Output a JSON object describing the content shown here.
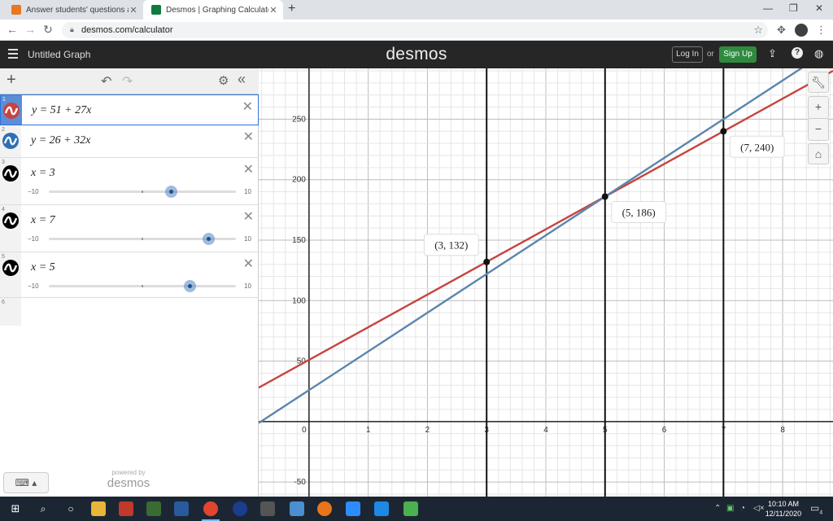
{
  "browser": {
    "tabs": [
      {
        "title": "Answer students' questions and e",
        "icon": "chegg-icon",
        "active": false
      },
      {
        "title": "Desmos | Graphing Calculator",
        "icon": "desmos-icon",
        "active": true
      }
    ],
    "url": "desmos.com/calculator"
  },
  "header": {
    "graph_title": "Untitled Graph",
    "logo": "desmos",
    "login_label": "Log In",
    "or_label": "or",
    "signup_label": "Sign Up"
  },
  "expressions": [
    {
      "index": "1",
      "latex": "y = 51 + 27x",
      "color": "#c74440",
      "selected": true
    },
    {
      "index": "2",
      "latex": "y = 26 + 32x",
      "color": "#2d70b3",
      "selected": false
    },
    {
      "index": "3",
      "latex": "x = 3",
      "color": "#000000",
      "slider": {
        "min": "−10",
        "max": "10",
        "value": 3
      }
    },
    {
      "index": "4",
      "latex": "x = 7",
      "color": "#000000",
      "slider": {
        "min": "−10",
        "max": "10",
        "value": 7
      }
    },
    {
      "index": "5",
      "latex": "x = 5",
      "color": "#000000",
      "slider": {
        "min": "−10",
        "max": "10",
        "value": 5
      }
    },
    {
      "index": "6",
      "latex": ""
    }
  ],
  "powered_by": {
    "small": "powered by",
    "brand": "desmos"
  },
  "graph": {
    "x_range": [
      -0.85,
      8.85
    ],
    "y_range": [
      -62,
      292
    ],
    "x_ticks": [
      "0",
      "1",
      "2",
      "3",
      "4",
      "5",
      "6",
      "7",
      "8"
    ],
    "y_ticks": [
      "-50",
      "50",
      "100",
      "150",
      "200",
      "250"
    ],
    "lines": [
      {
        "intercept": 51,
        "slope": 27,
        "color": "#c74440"
      },
      {
        "intercept": 26,
        "slope": 32,
        "color": "#5a86ad"
      }
    ],
    "vertical_lines": [
      3,
      5,
      7
    ],
    "points": [
      {
        "x": 3,
        "y": 132,
        "label": "(3, 132)",
        "label_side": "above-left"
      },
      {
        "x": 5,
        "y": 186,
        "label": "(5, 186)",
        "label_side": "below-right"
      },
      {
        "x": 7,
        "y": 240,
        "label": "(7, 240)",
        "label_side": "below-right"
      }
    ]
  },
  "taskbar": {
    "time": "10:10 AM",
    "date": "12/11/2020",
    "notifications": "4"
  }
}
